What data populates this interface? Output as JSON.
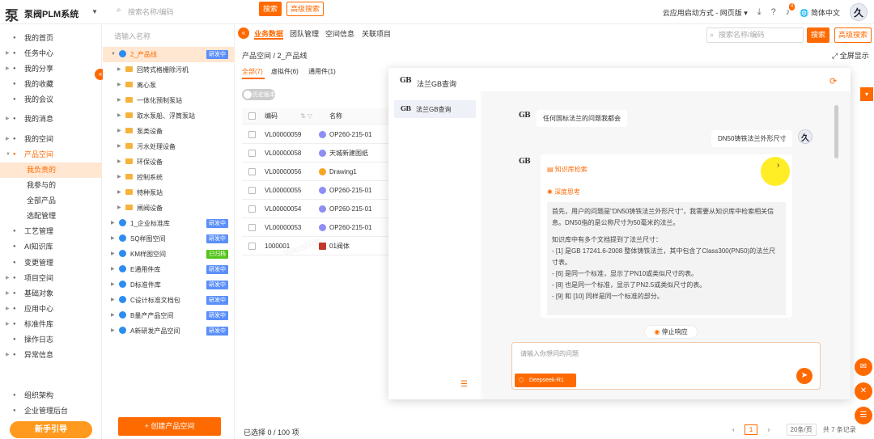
{
  "topbar": {
    "logo_mark": "泵",
    "app_title": "泵阀PLM系统",
    "search_placeholder": "搜索名称/编码",
    "search_btn": "搜索",
    "adv_search_btn": "高级搜索",
    "launch_mode": "云应用启动方式 - 网页版",
    "notif_count": "4",
    "lang": "简体中文",
    "avatar": "久"
  },
  "sidebar": {
    "items": [
      {
        "label": "我的首页",
        "icon": "home-icon"
      },
      {
        "label": "任务中心",
        "icon": "task-icon"
      },
      {
        "label": "我的分享",
        "icon": "share-icon"
      },
      {
        "label": "我的收藏",
        "icon": "star-icon"
      },
      {
        "label": "我的会议",
        "icon": "meeting-icon"
      },
      {
        "label": "我的消息",
        "icon": "bell-icon"
      },
      {
        "label": "我的空间",
        "icon": "space-icon"
      },
      {
        "label": "产品空间",
        "icon": "product-icon"
      },
      {
        "label": "我负责的"
      },
      {
        "label": "我参与的"
      },
      {
        "label": "全部产品"
      },
      {
        "label": "选配管理"
      },
      {
        "label": "工艺管理",
        "icon": "process-icon"
      },
      {
        "label": "AI知识库",
        "icon": "ai-icon"
      },
      {
        "label": "变更管理",
        "icon": "change-icon"
      },
      {
        "label": "项目空间",
        "icon": "project-icon"
      },
      {
        "label": "基础对象",
        "icon": "object-icon"
      },
      {
        "label": "应用中心",
        "icon": "app-icon"
      },
      {
        "label": "标准件库",
        "icon": "library-icon"
      },
      {
        "label": "操作日志",
        "icon": "log-icon"
      },
      {
        "label": "异常信息",
        "icon": "warning-icon"
      },
      {
        "label": "组织架构",
        "icon": "org-icon"
      },
      {
        "label": "企业管理后台",
        "icon": "admin-icon"
      }
    ],
    "guide_btn": "新手引导"
  },
  "tree": {
    "search_placeholder": "请输入名称",
    "nodes": [
      {
        "label": "2_产品线",
        "tag": "研发中",
        "type": "globe",
        "level": 0
      },
      {
        "label": "回转式格栅除污机",
        "type": "folder",
        "level": 1
      },
      {
        "label": "离心泵",
        "type": "folder",
        "level": 1
      },
      {
        "label": "一体化预制泵站",
        "type": "folder",
        "level": 1
      },
      {
        "label": "取水泵船、浮筒泵站",
        "type": "folder",
        "level": 1
      },
      {
        "label": "泵类设备",
        "type": "folder",
        "level": 1
      },
      {
        "label": "污水处理设备",
        "type": "folder",
        "level": 1
      },
      {
        "label": "环保设备",
        "type": "folder",
        "level": 1
      },
      {
        "label": "控制系统",
        "type": "folder",
        "level": 1
      },
      {
        "label": "特种泵站",
        "type": "folder",
        "level": 1
      },
      {
        "label": "闸阀设备",
        "type": "folder",
        "level": 1
      },
      {
        "label": "1_企业标准库",
        "tag": "研发中",
        "type": "globe",
        "level": 0
      },
      {
        "label": "SQ样图空间",
        "tag": "研发中",
        "type": "globe",
        "level": 0
      },
      {
        "label": "KM样图空间",
        "tag": "已归档",
        "type": "globe",
        "level": 0
      },
      {
        "label": "E通用件库",
        "tag": "研发中",
        "type": "globe",
        "level": 0
      },
      {
        "label": "D标准件库",
        "tag": "研发中",
        "type": "globe",
        "level": 0
      },
      {
        "label": "C设计标准文档包",
        "tag": "研发中",
        "type": "globe",
        "level": 0
      },
      {
        "label": "B量产产品空间",
        "tag": "研发中",
        "type": "globe",
        "level": 0
      },
      {
        "label": "A新研发产品空间",
        "tag": "研发中",
        "type": "globe",
        "level": 0
      }
    ],
    "create_btn": "+ 创建产品空间"
  },
  "main": {
    "tabs": [
      "业务数据",
      "团队管理",
      "空间信息",
      "关联项目"
    ],
    "search_placeholder": "搜索名称/编码",
    "search_btn": "搜索",
    "adv_search_btn": "高级搜索",
    "breadcrumb": "产品空间 / 2_产品线",
    "fullscreen": "全屏显示",
    "subtabs": [
      "全部(7)",
      "虚拟件(6)",
      "通用件(1)"
    ],
    "toggle_label": "历史版本",
    "columns": [
      "编码",
      "名称"
    ],
    "rows": [
      {
        "code": "VL00000059",
        "name": "OP260-215-01"
      },
      {
        "code": "VL00000058",
        "name": "天城新建图纸"
      },
      {
        "code": "VL00000056",
        "name": "Drawing1"
      },
      {
        "code": "VL00000055",
        "name": "OP260-215-01"
      },
      {
        "code": "VL00000054",
        "name": "OP260-215-01"
      },
      {
        "code": "VL00000053",
        "name": "OP260-215-01"
      },
      {
        "code": "1000001",
        "name": "01阀体"
      }
    ],
    "selected_text": "已选择 0 / 100 项",
    "page": "1",
    "page_size": "20条/页",
    "total": "共 7 条记录"
  },
  "dialog": {
    "title": "法兰GB查询",
    "gb_logo": "GB",
    "side_item": "法兰GB查询",
    "greeting": "任何国标法兰的问题我都会",
    "user_question": "DN50铸铁法兰外形尺寸",
    "knowledge_label": "知识库检索",
    "thinking_label": "深度思考",
    "thinking_lines": [
      "首先，用户的问题是\"DN50铸铁法兰外形尺寸\"，我需要从知识库中检索相关信息。DN50指的是公称尺寸为50毫米的法兰。",
      "知识库中有多个文档提到了法兰尺寸：",
      "- [1] 是GB 17241.6-2008 整体铸铁法兰，其中包含了Class300(PN50)的法兰尺寸表。",
      "- [6] 是同一个标准，显示了PN10或类似尺寸的表。",
      "- [8] 也是同一个标准，显示了PN2.5或类似尺寸的表。",
      "- [9] 和 [10] 同样是同一个标准的部分。"
    ],
    "stop_btn": "停止响应",
    "input_placeholder": "请输入你想问的问题",
    "model_btn": "Deepseek-R1"
  },
  "colors": {
    "accent": "#ff6a00",
    "tag_blue": "#5b8ff9",
    "tag_green": "#52c41a"
  }
}
